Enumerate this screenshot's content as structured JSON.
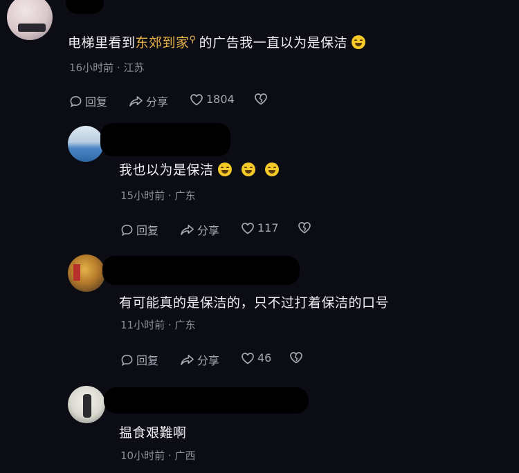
{
  "comments": [
    {
      "text_pre": "电梯里看到",
      "link": "东郊到家",
      "text_post": "的广告我一直以为是保洁",
      "emojis": [
        {
          "name": "laugh-cry-emoji"
        }
      ],
      "time": "16小时前",
      "sep": "·",
      "location": "江苏",
      "reply_label": "回复",
      "share_label": "分享",
      "likes": "1804"
    },
    {
      "text": "我也以为是保洁",
      "emojis": [
        {
          "name": "laugh-cry-emoji"
        },
        {
          "name": "laugh-cry-emoji"
        },
        {
          "name": "laugh-cry-emoji"
        }
      ],
      "time": "15小时前",
      "sep": "·",
      "location": "广东",
      "reply_label": "回复",
      "share_label": "分享",
      "likes": "117"
    },
    {
      "text": "有可能真的是保洁的，只不过打着保洁的口号",
      "time": "11小时前",
      "sep": "·",
      "location": "广东",
      "reply_label": "回复",
      "share_label": "分享",
      "likes": "46"
    },
    {
      "text": "揾食艰難啊",
      "time": "10小时前",
      "sep": "·",
      "location": "广西"
    }
  ],
  "colors": {
    "background": "#0b0c14",
    "link": "#e9b449",
    "meta": "#8b8d99"
  }
}
